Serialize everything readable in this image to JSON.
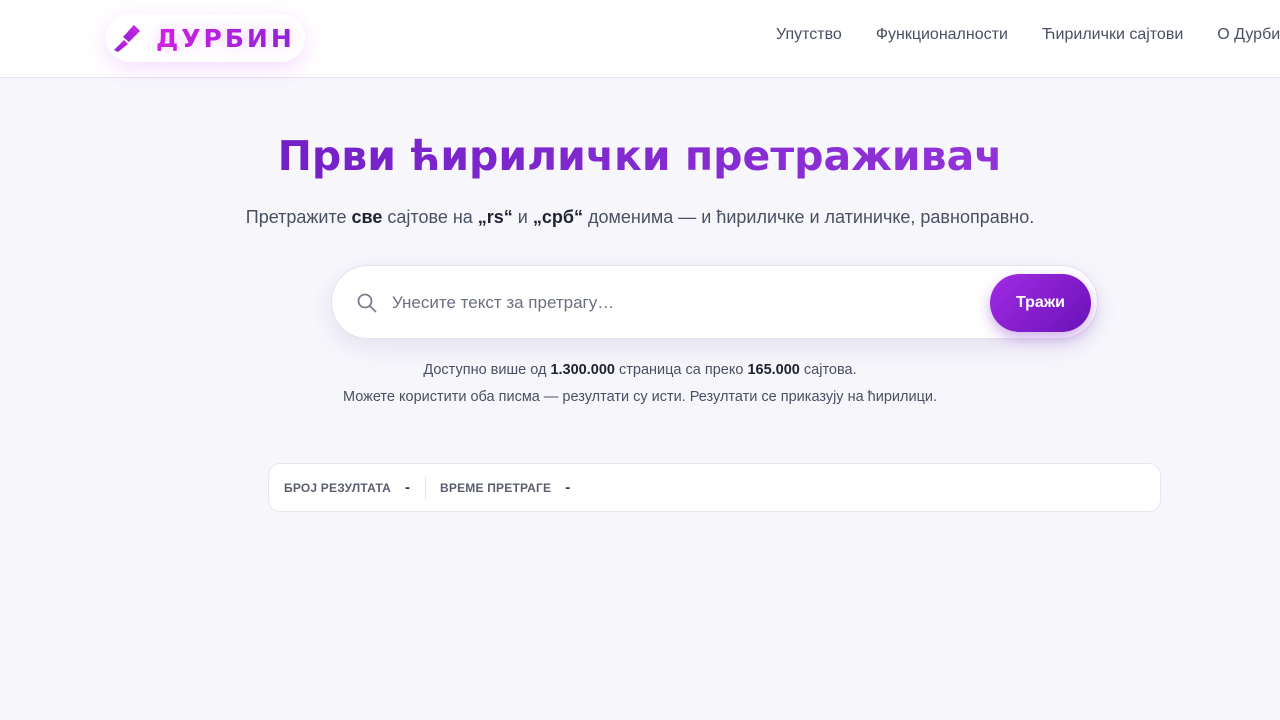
{
  "header": {
    "logo_text": "ДУРБИН",
    "logo_icon": "telescope-icon",
    "nav": [
      {
        "label": "Упутство"
      },
      {
        "label": "Функционалности"
      },
      {
        "label": "Ћирилички сајтови"
      },
      {
        "label": "О Дурбину"
      }
    ]
  },
  "hero": {
    "title": "Први ћирилички претраживач",
    "subtitle_part1": "Претражите ",
    "subtitle_bold1": "све",
    "subtitle_part2": " сајтове на ",
    "subtitle_bold2": "„rs“",
    "subtitle_part3": " и ",
    "subtitle_bold3": "„срб“",
    "subtitle_part4": " доменима — и ћириличке и латиничке, равноправно."
  },
  "search": {
    "placeholder": "Унесите текст за претрагу…",
    "value": "",
    "button_label": "Тражи",
    "icon": "search-icon"
  },
  "info": {
    "line1_part1": "Доступно више од ",
    "line1_pages": "1.300.000",
    "line1_part2": " страница са преко ",
    "line1_sites": "165.000",
    "line1_part3": " сајтова.",
    "line2": "Можете користити оба писма — резултати су исти. Резултати се приказују на ћирилици."
  },
  "stats": {
    "results_label": "БРОЈ РЕЗУЛТАТА",
    "results_value": "-",
    "time_label": "ВРЕМЕ ПРЕТРАГЕ",
    "time_value": "-"
  },
  "colors": {
    "accent": "#7a1fc6",
    "button": "#8a1fd0",
    "background": "#f6f6fb"
  }
}
